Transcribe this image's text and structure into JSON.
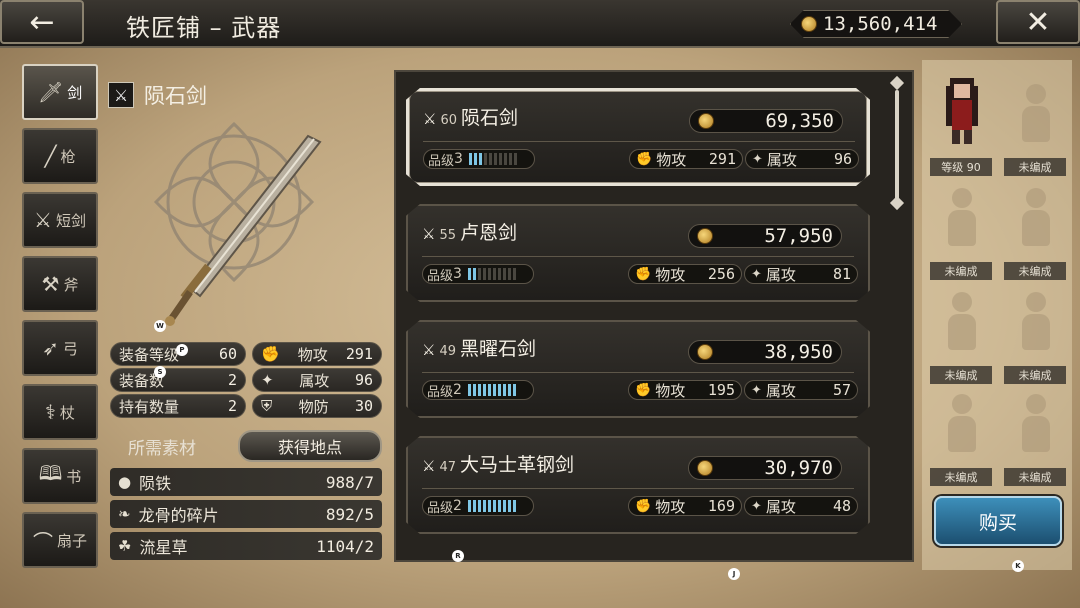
{
  "header": {
    "back_icon": "arrow-left-icon",
    "title": "铁匠铺 – 武器",
    "gold": "13,560,414",
    "close_icon": "close-icon"
  },
  "categories": [
    {
      "label": "剑",
      "icon": "sword-icon",
      "active": true
    },
    {
      "label": "枪",
      "icon": "spear-icon"
    },
    {
      "label": "短剑",
      "icon": "dagger-icon"
    },
    {
      "label": "斧",
      "icon": "axe-icon"
    },
    {
      "label": "弓",
      "icon": "bow-icon"
    },
    {
      "label": "杖",
      "icon": "staff-icon"
    },
    {
      "label": "书",
      "icon": "book-icon"
    },
    {
      "label": "扇子",
      "icon": "fan-icon"
    }
  ],
  "detail": {
    "name": "陨石剑",
    "stats": [
      {
        "label": "装备等级",
        "value": "60",
        "label2": "物攻",
        "value2": "291"
      },
      {
        "label": "装备数",
        "value": "2",
        "label2": "属攻",
        "value2": "96"
      },
      {
        "label": "持有数量",
        "value": "2",
        "label2": "物防",
        "value2": "30"
      }
    ],
    "materials_label": "所需素材",
    "obtain_button": "获得地点",
    "materials": [
      {
        "name": "陨铁",
        "value": "988/7"
      },
      {
        "name": "龙骨的碎片",
        "value": "892/5"
      },
      {
        "name": "流星草",
        "value": "1104/2"
      }
    ],
    "key_hints": {
      "w": "W",
      "a": "P",
      "s": "S"
    }
  },
  "weapons": [
    {
      "level": "60",
      "name": "陨石剑",
      "price": "69,350",
      "grade_label": "品级",
      "grade": "3",
      "grade_fill": 3,
      "phys_label": "物攻",
      "phys": "291",
      "elem_label": "属攻",
      "elem": "96",
      "selected": true
    },
    {
      "level": "55",
      "name": "卢恩剑",
      "price": "57,950",
      "grade_label": "品级",
      "grade": "3",
      "grade_fill": 2,
      "phys_label": "物攻",
      "phys": "256",
      "elem_label": "属攻",
      "elem": "81"
    },
    {
      "level": "49",
      "name": "黑曜石剑",
      "price": "38,950",
      "grade_label": "品级",
      "grade": "2",
      "grade_fill": 10,
      "phys_label": "物攻",
      "phys": "195",
      "elem_label": "属攻",
      "elem": "57"
    },
    {
      "level": "47",
      "name": "大马士革钢剑",
      "price": "30,970",
      "grade_label": "品级",
      "grade": "2",
      "grade_fill": 10,
      "phys_label": "物攻",
      "phys": "169",
      "elem_label": "属攻",
      "elem": "48"
    }
  ],
  "party": {
    "hero_label": "等级 90",
    "empty_label": "未编成"
  },
  "buy_button": "购买",
  "key_hints_misc": {
    "r": "R",
    "j": "J",
    "k": "K"
  },
  "colors": {
    "accent_blue": "#3d8fba",
    "grade_bar": "#7fc7e6",
    "panel_dark": "#27241f",
    "parchment": "#c9b08a"
  }
}
